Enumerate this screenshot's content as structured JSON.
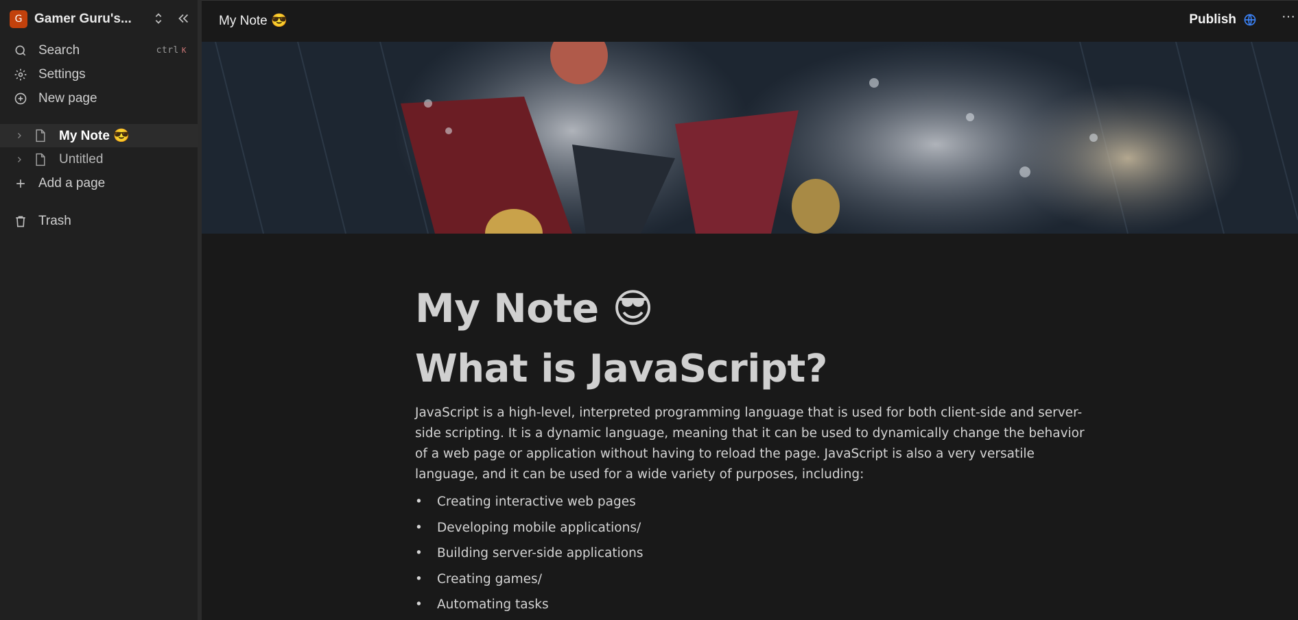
{
  "sidebar": {
    "workspace": {
      "avatar_letter": "G",
      "name": "Gamer Guru's...",
      "accent": "#c2410c"
    },
    "search": {
      "label": "Search",
      "shortcut": "ctrl",
      "shortcut_key": "K"
    },
    "settings": {
      "label": "Settings"
    },
    "new_page": {
      "label": "New page"
    },
    "pages": [
      {
        "label": "My Note 😎",
        "active": true
      },
      {
        "label": "Untitled",
        "active": false
      }
    ],
    "add_page": {
      "label": "Add a page"
    },
    "trash": {
      "label": "Trash"
    }
  },
  "topbar": {
    "breadcrumb": "My Note 😎",
    "publish_label": "Publish",
    "more_label": "···"
  },
  "document": {
    "title": "My Note 😎",
    "heading": "What is JavaScript?",
    "paragraph": "JavaScript is a high-level, interpreted programming language that is used for both client-side and server-side scripting. It is a dynamic language, meaning that it can be used to dynamically change the behavior of a web page or application without having to reload the page. JavaScript is also a very versatile language, and it can be used for a wide variety of purposes, including:",
    "bullets": [
      "Creating interactive web pages",
      "Developing mobile applications/",
      "Building server-side applications",
      "Creating games/",
      "Automating tasks"
    ]
  },
  "icons": {
    "search": "search-icon",
    "settings": "gear-icon",
    "new_page": "plus-circle-icon",
    "add_page": "plus-icon",
    "trash": "trash-icon",
    "page": "document-icon",
    "publish": "globe-icon"
  }
}
